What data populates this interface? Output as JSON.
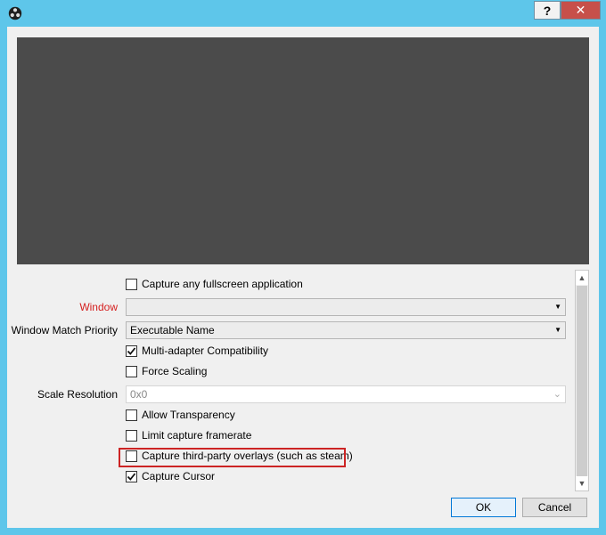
{
  "titlebar": {
    "app_icon": "obs-logo-icon",
    "help_label": "?",
    "close_label": "✕"
  },
  "properties": {
    "capture_fullscreen": {
      "label": "Capture any fullscreen application",
      "checked": false
    },
    "window": {
      "label": "Window",
      "value": ""
    },
    "window_match_priority": {
      "label": "Window Match Priority",
      "value": "Executable Name"
    },
    "multi_adapter": {
      "label": "Multi-adapter Compatibility",
      "checked": true
    },
    "force_scaling": {
      "label": "Force Scaling",
      "checked": false
    },
    "scale_resolution": {
      "label": "Scale Resolution",
      "value": "0x0"
    },
    "allow_transparency": {
      "label": "Allow Transparency",
      "checked": false
    },
    "limit_framerate": {
      "label": "Limit capture framerate",
      "checked": false
    },
    "third_party_overlays": {
      "label": "Capture third-party overlays (such as steam)",
      "checked": false
    },
    "capture_cursor": {
      "label": "Capture Cursor",
      "checked": true
    }
  },
  "buttons": {
    "ok": "OK",
    "cancel": "Cancel"
  },
  "colors": {
    "title_bar": "#5ec6ea",
    "preview": "#4b4b4b",
    "required_label": "#d52020",
    "highlight_box": "#cc2424"
  }
}
